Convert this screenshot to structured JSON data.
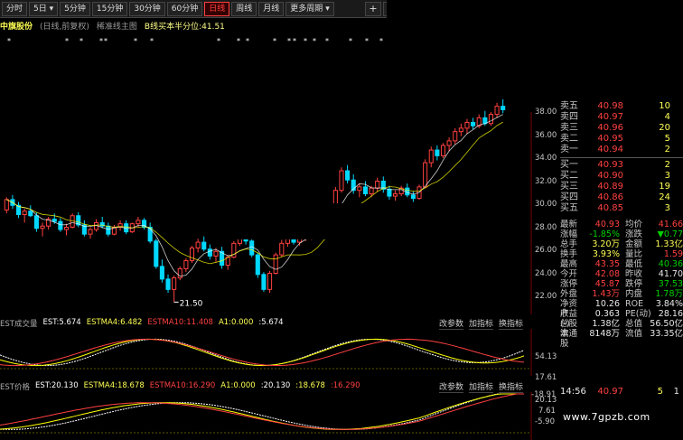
{
  "toolbar": {
    "buttons": [
      "分时",
      "5日",
      "5分钟",
      "15分钟",
      "30分钟",
      "60分钟",
      "日线",
      "周线",
      "月线",
      "更多周期"
    ],
    "active": "日线",
    "icons": [
      "+",
      "−"
    ]
  },
  "title": {
    "stock_name": "中旗股份",
    "sub": "(日线,前复权)",
    "main": "稀准线主图",
    "indicator": "B线买本半分位:41.51"
  },
  "price_axis": [
    "38.00",
    "36.00",
    "34.00",
    "32.00",
    "30.00",
    "28.00",
    "26.00",
    "24.00",
    "22.00"
  ],
  "low_marker": "21.50",
  "vol_panel": {
    "label": "EST成交量",
    "est": "EST:5.674",
    "estma4": "ESTMA4:6.482",
    "estma10": "ESTMA10:11.408",
    "a1": "A1:0.000",
    "extra": ":5.674",
    "axis": [
      "54.13",
      "17.61",
      "-18.91"
    ],
    "buttons": [
      "改参数",
      "加指标",
      "换指标"
    ]
  },
  "ind_panel": {
    "label": "EST价格",
    "est": "EST:20.130",
    "estma4": "ESTMA4:18.678",
    "estma10": "ESTMA10:16.290",
    "a1": "A1:0.000",
    "extra1": ":20.130",
    "extra2": ":18.678",
    "extra3": ":16.290",
    "axis": [
      "20.13",
      "7.61",
      "-5.90"
    ],
    "buttons": [
      "改参数",
      "加指标",
      "换指标"
    ]
  },
  "orderbook": {
    "asks": [
      {
        "label": "卖五",
        "price": "40.98",
        "vol": "10"
      },
      {
        "label": "卖四",
        "price": "40.97",
        "vol": "4"
      },
      {
        "label": "卖三",
        "price": "40.96",
        "vol": "20"
      },
      {
        "label": "卖二",
        "price": "40.95",
        "vol": "5"
      },
      {
        "label": "卖一",
        "price": "40.94",
        "vol": "2"
      }
    ],
    "bids": [
      {
        "label": "买一",
        "price": "40.93",
        "vol": "2"
      },
      {
        "label": "买二",
        "price": "40.90",
        "vol": "3"
      },
      {
        "label": "买三",
        "price": "40.89",
        "vol": "19"
      },
      {
        "label": "买四",
        "price": "40.86",
        "vol": "24"
      },
      {
        "label": "买五",
        "price": "40.85",
        "vol": "3"
      }
    ]
  },
  "quote": [
    {
      "l1": "最新",
      "v1": "40.93",
      "c1": "red",
      "l2": "均价",
      "v2": "41.66",
      "c2": "red"
    },
    {
      "l1": "涨幅",
      "v1": "-1.85%",
      "c1": "green",
      "l2": "涨跌",
      "v2": "▼0.77",
      "c2": "green"
    },
    {
      "l1": "总手",
      "v1": "3.20万",
      "c1": "yellow",
      "l2": "金额",
      "v2": "1.33亿",
      "c2": "yellow"
    },
    {
      "l1": "换手",
      "v1": "3.93%",
      "c1": "yellow",
      "l2": "量比",
      "v2": "1.59",
      "c2": "red"
    },
    {
      "l1": "最高",
      "v1": "43.35",
      "c1": "red",
      "l2": "最低",
      "v2": "40.36",
      "c2": "green"
    },
    {
      "l1": "今开",
      "v1": "42.08",
      "c1": "red",
      "l2": "昨收",
      "v2": "41.70",
      "c2": "white"
    },
    {
      "l1": "涨停",
      "v1": "45.87",
      "c1": "red",
      "l2": "跌停",
      "v2": "37.53",
      "c2": "green"
    },
    {
      "l1": "外盘",
      "v1": "1.43万",
      "c1": "red",
      "l2": "内盘",
      "v2": "1.78万",
      "c2": "green"
    },
    {
      "l1": "净资产",
      "v1": "10.26",
      "c1": "white",
      "l2": "ROE",
      "v2": "3.84%",
      "c2": "white"
    },
    {
      "l1": "收益(-)",
      "v1": "0.363",
      "c1": "white",
      "l2": "PE(动)",
      "v2": "28.16",
      "c2": "white"
    },
    {
      "l1": "总股本",
      "v1": "1.38亿",
      "c1": "white",
      "l2": "总值",
      "v2": "56.50亿",
      "c2": "white"
    },
    {
      "l1": "流通股",
      "v1": "8148万",
      "c1": "white",
      "l2": "流值",
      "v2": "33.35亿",
      "c2": "white"
    }
  ],
  "tick": {
    "time": "14:56",
    "price": "40.97",
    "vol": "5",
    "flag": "1"
  },
  "watermark": "www.7gpzb.com",
  "colors": {
    "up": "#ff4040",
    "down": "#00d8ff",
    "bg": "#000000",
    "ma_white": "#ffffff",
    "ma_yellow": "#ffff00"
  },
  "chart_data": {
    "type": "candlestick",
    "price_range": [
      21,
      39.5
    ],
    "candles": [
      [
        29.5,
        30.6,
        29.2,
        30.4
      ],
      [
        30.4,
        30.8,
        29.6,
        29.9
      ],
      [
        29.9,
        30.2,
        28.8,
        29.1
      ],
      [
        29.1,
        29.6,
        28.4,
        29.4
      ],
      [
        29.4,
        29.9,
        28.9,
        29.0
      ],
      [
        29.0,
        29.3,
        27.6,
        27.9
      ],
      [
        27.9,
        28.4,
        27.2,
        28.1
      ],
      [
        28.1,
        28.9,
        27.8,
        28.7
      ],
      [
        28.7,
        29.2,
        28.3,
        28.5
      ],
      [
        28.5,
        28.8,
        27.6,
        27.8
      ],
      [
        27.8,
        28.3,
        27.3,
        28.0
      ],
      [
        28.0,
        29.2,
        27.9,
        29.0
      ],
      [
        29.0,
        29.3,
        28.0,
        28.2
      ],
      [
        28.2,
        28.6,
        27.2,
        27.4
      ],
      [
        27.4,
        28.0,
        27.0,
        27.8
      ],
      [
        27.8,
        28.7,
        27.6,
        28.4
      ],
      [
        28.4,
        28.9,
        27.9,
        28.1
      ],
      [
        28.1,
        28.4,
        27.2,
        27.4
      ],
      [
        27.4,
        28.2,
        27.3,
        28.0
      ],
      [
        28.0,
        28.6,
        27.7,
        28.3
      ],
      [
        28.3,
        28.6,
        27.4,
        27.6
      ],
      [
        27.6,
        28.4,
        27.5,
        28.3
      ],
      [
        28.3,
        28.9,
        28.0,
        28.6
      ],
      [
        28.6,
        28.8,
        27.8,
        28.0
      ],
      [
        28.0,
        28.4,
        26.6,
        26.8
      ],
      [
        26.8,
        27.0,
        24.4,
        24.6
      ],
      [
        24.6,
        25.2,
        23.2,
        23.5
      ],
      [
        23.5,
        23.9,
        22.3,
        22.6
      ],
      [
        22.6,
        23.8,
        21.5,
        23.6
      ],
      [
        23.6,
        24.6,
        23.4,
        24.4
      ],
      [
        24.4,
        25.3,
        24.1,
        25.1
      ],
      [
        25.1,
        26.4,
        24.9,
        26.2
      ],
      [
        26.2,
        27.0,
        25.8,
        26.7
      ],
      [
        26.7,
        27.2,
        25.9,
        26.1
      ],
      [
        26.1,
        26.5,
        25.2,
        25.5
      ],
      [
        25.5,
        26.2,
        25.0,
        25.9
      ],
      [
        25.9,
        26.3,
        24.4,
        24.7
      ],
      [
        24.7,
        25.6,
        24.3,
        25.4
      ],
      [
        25.4,
        26.8,
        25.3,
        26.6
      ],
      [
        26.6,
        27.5,
        26.4,
        27.2
      ],
      [
        27.2,
        27.6,
        26.5,
        26.8
      ],
      [
        26.8,
        27.0,
        25.4,
        25.6
      ],
      [
        25.6,
        25.8,
        23.6,
        23.9
      ],
      [
        23.9,
        24.1,
        22.4,
        22.6
      ],
      [
        22.6,
        24.2,
        22.3,
        24.0
      ],
      [
        24.0,
        25.8,
        23.9,
        25.6
      ],
      [
        25.6,
        26.9,
        25.4,
        26.6
      ],
      [
        26.6,
        27.4,
        26.3,
        27.1
      ],
      [
        27.1,
        27.4,
        26.5,
        26.7
      ],
      [
        26.7,
        27.3,
        26.4,
        27.0
      ],
      [
        27.0,
        27.6,
        26.8,
        27.3
      ],
      [
        27.3,
        27.8,
        26.9,
        27.5
      ],
      [
        27.5,
        28.2,
        27.3,
        28.0
      ],
      [
        28.0,
        28.9,
        27.8,
        28.6
      ],
      [
        28.6,
        29.4,
        28.4,
        29.2
      ],
      [
        29.2,
        31.5,
        29.0,
        31.2
      ],
      [
        31.2,
        33.2,
        31.0,
        32.9
      ],
      [
        32.9,
        33.4,
        31.8,
        32.1
      ],
      [
        32.1,
        32.6,
        30.9,
        31.2
      ],
      [
        31.2,
        31.8,
        30.6,
        31.5
      ],
      [
        31.5,
        32.0,
        30.7,
        30.9
      ],
      [
        30.9,
        31.6,
        30.6,
        31.4
      ],
      [
        31.4,
        32.3,
        31.1,
        32.0
      ],
      [
        32.0,
        32.4,
        31.0,
        31.3
      ],
      [
        31.3,
        31.6,
        30.4,
        30.7
      ],
      [
        30.7,
        31.2,
        30.3,
        30.9
      ],
      [
        30.9,
        31.6,
        30.7,
        31.4
      ],
      [
        31.4,
        31.8,
        30.6,
        30.8
      ],
      [
        30.8,
        31.1,
        30.2,
        30.5
      ],
      [
        30.5,
        31.7,
        30.4,
        31.5
      ],
      [
        31.5,
        33.9,
        31.4,
        33.6
      ],
      [
        33.6,
        35.0,
        33.2,
        34.7
      ],
      [
        34.7,
        35.1,
        33.8,
        34.2
      ],
      [
        34.2,
        35.3,
        34.0,
        35.1
      ],
      [
        35.1,
        35.8,
        34.6,
        35.5
      ],
      [
        35.5,
        36.6,
        35.2,
        36.3
      ],
      [
        36.3,
        37.0,
        35.9,
        36.6
      ],
      [
        36.6,
        37.4,
        36.1,
        37.1
      ],
      [
        37.1,
        37.5,
        36.5,
        36.8
      ],
      [
        36.8,
        37.8,
        36.6,
        37.5
      ],
      [
        37.5,
        38.1,
        36.8,
        37.0
      ],
      [
        37.0,
        38.0,
        36.8,
        37.8
      ],
      [
        37.8,
        38.8,
        37.5,
        38.5
      ],
      [
        38.5,
        39.1,
        37.9,
        38.2
      ]
    ]
  }
}
